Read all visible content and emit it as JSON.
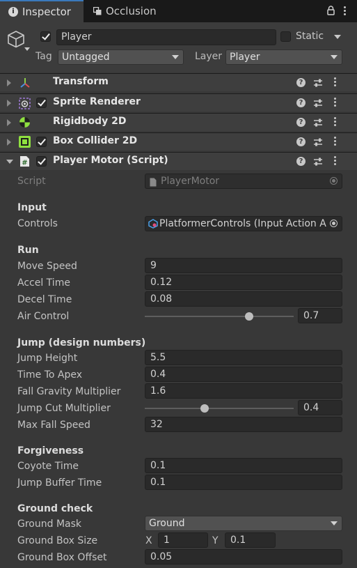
{
  "tabs": [
    {
      "label": "Inspector",
      "icon": "info-icon",
      "active": true
    },
    {
      "label": "Occlusion",
      "icon": "occlusion-icon",
      "active": false
    }
  ],
  "header": {
    "object_name": "Player",
    "active": true,
    "static_label": "Static",
    "static_checked": false,
    "tag_label": "Tag",
    "tag_value": "Untagged",
    "layer_label": "Layer",
    "layer_value": "Player"
  },
  "components": [
    {
      "title": "Transform",
      "icon": "transform-icon",
      "has_toggle": false,
      "expanded": false
    },
    {
      "title": "Sprite Renderer",
      "icon": "sprite-renderer-icon",
      "has_toggle": true,
      "enabled": true,
      "expanded": false
    },
    {
      "title": "Rigidbody 2D",
      "icon": "rigidbody-2d-icon",
      "has_toggle": false,
      "expanded": false
    },
    {
      "title": "Box Collider 2D",
      "icon": "box-collider-2d-icon",
      "has_toggle": true,
      "enabled": true,
      "expanded": false
    },
    {
      "title": "Player Motor (Script)",
      "icon": "script-icon",
      "has_toggle": true,
      "enabled": true,
      "expanded": true
    }
  ],
  "script": {
    "label": "Script",
    "value": "PlayerMotor"
  },
  "sections": {
    "input": {
      "header": "Input",
      "controls_label": "Controls",
      "controls_value": "PlatformerControls (Input Action A"
    },
    "run": {
      "header": "Run",
      "move_speed": {
        "label": "Move Speed",
        "value": "9"
      },
      "accel_time": {
        "label": "Accel Time",
        "value": "0.12"
      },
      "decel_time": {
        "label": "Decel Time",
        "value": "0.08"
      },
      "air_control": {
        "label": "Air Control",
        "value": "0.7",
        "fraction": 0.7
      }
    },
    "jump": {
      "header": "Jump (design numbers)",
      "jump_height": {
        "label": "Jump Height",
        "value": "5.5"
      },
      "time_to_apex": {
        "label": "Time To Apex",
        "value": "0.4"
      },
      "fall_gravity": {
        "label": "Fall Gravity Multiplier",
        "value": "1.6"
      },
      "jump_cut": {
        "label": "Jump Cut Multiplier",
        "value": "0.4",
        "fraction": 0.4
      },
      "max_fall": {
        "label": "Max Fall Speed",
        "value": "32"
      }
    },
    "forgiveness": {
      "header": "Forgiveness",
      "coyote_time": {
        "label": "Coyote Time",
        "value": "0.1"
      },
      "jump_buffer": {
        "label": "Jump Buffer Time",
        "value": "0.1"
      }
    },
    "ground": {
      "header": "Ground check",
      "mask": {
        "label": "Ground Mask",
        "value": "Ground"
      },
      "box_size": {
        "label": "Ground Box Size",
        "x_label": "X",
        "x": "1",
        "y_label": "Y",
        "y": "0.1"
      },
      "box_offset": {
        "label": "Ground Box Offset",
        "value": "0.05"
      }
    }
  },
  "colors": {
    "panel_bg": "#383838",
    "tab_bar": "#191919",
    "field_bg": "#2a2a2a",
    "accent_blue": "#3a79bb",
    "physics_green": "#8fe040"
  }
}
